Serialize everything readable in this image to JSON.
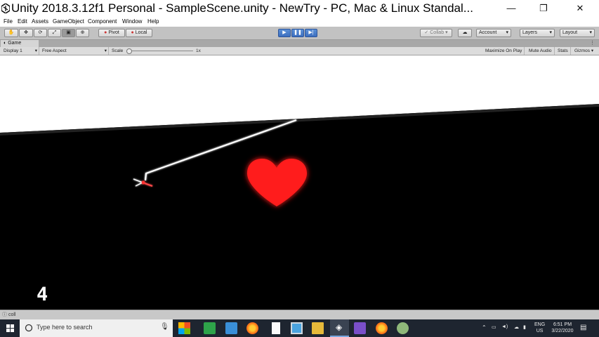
{
  "window": {
    "title": "Unity 2018.3.12f1 Personal - SampleScene.unity - NewTry - PC, Mac & Linux Standal...",
    "minimize_icon": "minimize-icon",
    "maximize_icon": "restore-icon",
    "close_icon": "close-icon"
  },
  "menu": [
    "File",
    "Edit",
    "Assets",
    "GameObject",
    "Component",
    "Window",
    "Help"
  ],
  "toolbar": {
    "pivot_label": "Pivot",
    "local_label": "Local",
    "collab_label": "Collab",
    "account_label": "Account",
    "layers_label": "Layers",
    "layout_label": "Layout"
  },
  "game_tab": {
    "label": "Game",
    "display": "Display 1",
    "aspect": "Free Aspect",
    "scale_label": "Scale",
    "scale_value": "1x",
    "maximize_on_play": "Maximize On Play",
    "mute_audio": "Mute Audio",
    "stats": "Stats",
    "gizmos": "Gizmos"
  },
  "game": {
    "score": "4",
    "heart_color": "#ff1a1a",
    "line_color": "#ffffff"
  },
  "status": {
    "message": "coll"
  },
  "taskbar": {
    "search_placeholder": "Type here to search",
    "lang_line1": "ENG",
    "lang_line2": "US",
    "time": "6:51 PM",
    "date": "3/22/2020"
  }
}
